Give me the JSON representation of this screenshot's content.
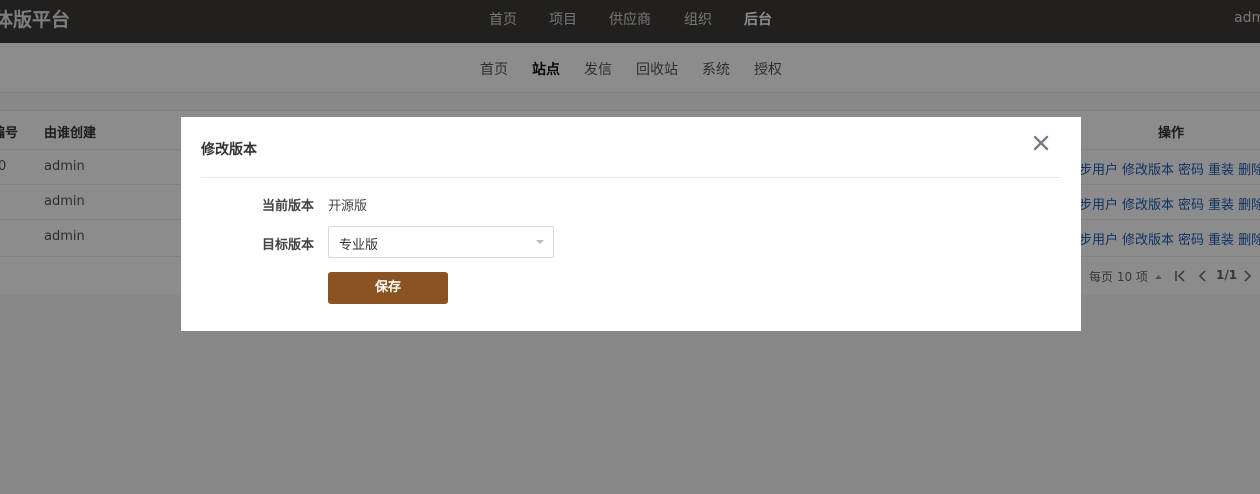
{
  "header": {
    "brand": "体版平台",
    "nav": [
      "首页",
      "项目",
      "供应商",
      "组织",
      "后台"
    ],
    "active_nav": "后台",
    "user": "adm"
  },
  "subnav": {
    "items": [
      "首页",
      "站点",
      "发信",
      "回收站",
      "系统",
      "授权"
    ],
    "active": "站点"
  },
  "table": {
    "headers": {
      "id": "编号",
      "creator": "由谁创建",
      "ops": "操作"
    },
    "rows": [
      {
        "id": "0",
        "creator": "admin"
      },
      {
        "id": "",
        "creator": "admin"
      },
      {
        "id": "",
        "creator": "admin"
      }
    ],
    "row_actions": [
      "同步用户",
      "修改版本",
      "密码",
      "重装",
      "删除"
    ],
    "pager": {
      "per_page": "每页 10 项",
      "page": "1/1"
    }
  },
  "modal": {
    "title": "修改版本",
    "current_label": "当前版本",
    "current_value": "开源版",
    "target_label": "目标版本",
    "target_value": "专业版",
    "save_label": "保存"
  },
  "colors": {
    "topbar": "#3f3b39",
    "accent": "#8a5320",
    "link": "#1e5bb8"
  }
}
